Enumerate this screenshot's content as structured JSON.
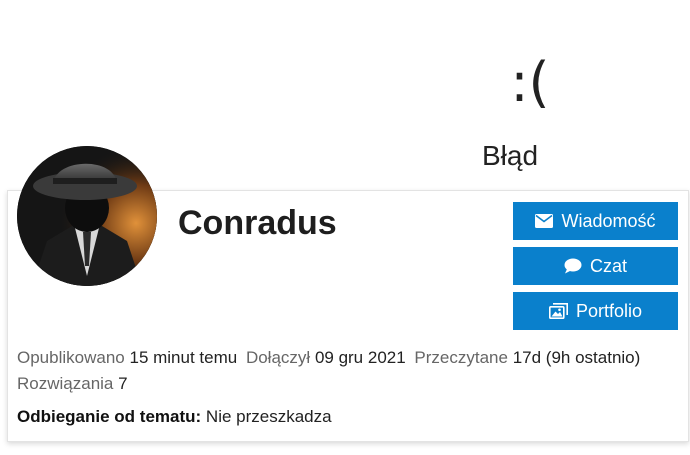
{
  "error": {
    "face": ":(",
    "message": "Błąd"
  },
  "profile": {
    "username": "Conradus",
    "avatar_alt": "avatar",
    "buttons": {
      "message": {
        "label": "Wiadomość",
        "icon": "envelope-icon"
      },
      "chat": {
        "label": "Czat",
        "icon": "chat-bubble-icon"
      },
      "portfolio": {
        "label": "Portfolio",
        "icon": "images-icon"
      }
    },
    "stats": {
      "published_label": "Opublikowano",
      "published_value": "15 minut temu",
      "joined_label": "Dołączył",
      "joined_value": "09 gru 2021",
      "read_label": "Przeczytane",
      "read_value": "17d (9h ostatnio)",
      "solutions_label": "Rozwiązania",
      "solutions_value": "7"
    },
    "offtopic": {
      "label": "Odbieganie od tematu:",
      "value": "Nie przeszkadza"
    }
  },
  "colors": {
    "button_bg": "#0a80cc",
    "button_text": "#ffffff",
    "muted_text": "#666666"
  }
}
